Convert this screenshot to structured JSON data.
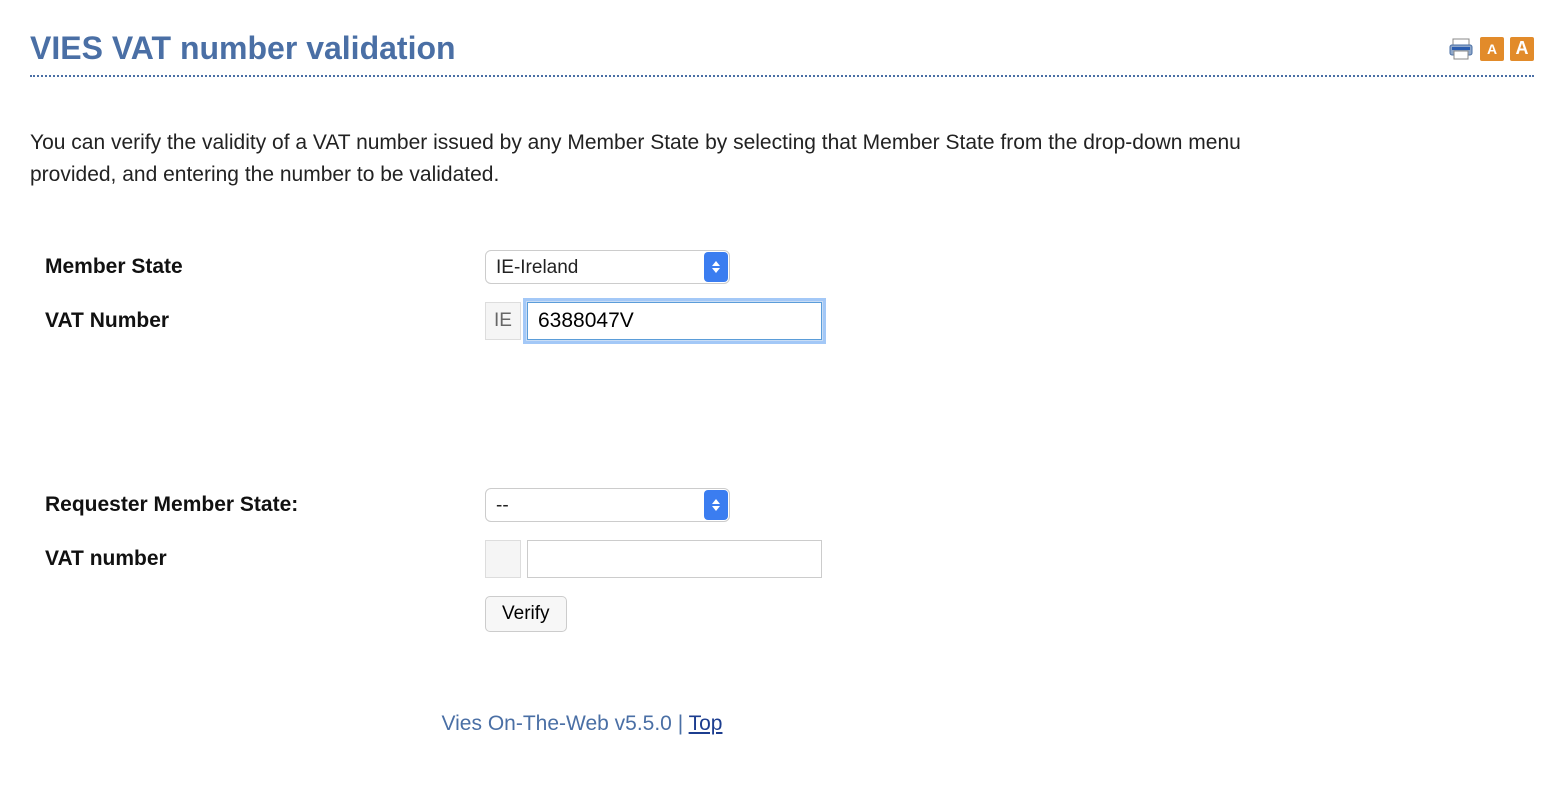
{
  "header": {
    "title": "VIES VAT number validation",
    "icons": {
      "print": "print-icon",
      "fontSmall": "A",
      "fontLarge": "A"
    }
  },
  "intro": "You can verify the validity of a VAT number issued by any Member State by selecting that Member State from the drop-down menu provided, and entering the number to be validated.",
  "form": {
    "memberState": {
      "label": "Member State",
      "selected": "IE-Ireland"
    },
    "vatNumber": {
      "label": "VAT Number",
      "prefix": "IE",
      "value": "6388047V"
    },
    "requesterMemberState": {
      "label": "Requester Member State:",
      "selected": "--"
    },
    "requesterVatNumber": {
      "label": "VAT number",
      "prefix": "",
      "value": ""
    },
    "verifyButton": "Verify"
  },
  "footer": {
    "version": "Vies On-The-Web v5.5.0",
    "sep": " | ",
    "topLink": "Top"
  }
}
